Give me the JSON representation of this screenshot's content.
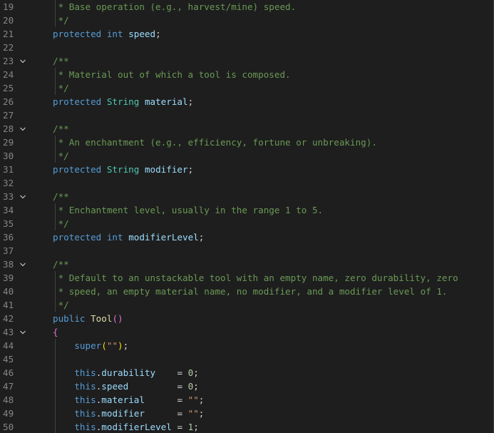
{
  "editor": {
    "lines": [
      {
        "n": "19",
        "fold": false,
        "guide": 1,
        "tokens": [
          {
            "c": "cm",
            "t": " * Base operation (e.g., harvest/mine) speed."
          }
        ]
      },
      {
        "n": "20",
        "fold": false,
        "guide": 1,
        "tokens": [
          {
            "c": "cm",
            "t": " */"
          }
        ]
      },
      {
        "n": "21",
        "fold": false,
        "guide": 0,
        "tokens": [
          {
            "c": "kw",
            "t": "protected"
          },
          {
            "c": "op",
            "t": " "
          },
          {
            "c": "kw",
            "t": "int"
          },
          {
            "c": "op",
            "t": " "
          },
          {
            "c": "id",
            "t": "speed"
          },
          {
            "c": "op",
            "t": ";"
          }
        ]
      },
      {
        "n": "22",
        "fold": false,
        "guide": 0,
        "tokens": []
      },
      {
        "n": "23",
        "fold": true,
        "guide": 0,
        "tokens": [
          {
            "c": "cm",
            "t": "/**"
          }
        ]
      },
      {
        "n": "24",
        "fold": false,
        "guide": 1,
        "tokens": [
          {
            "c": "cm",
            "t": " * Material out of which a tool is composed."
          }
        ]
      },
      {
        "n": "25",
        "fold": false,
        "guide": 1,
        "tokens": [
          {
            "c": "cm",
            "t": " */"
          }
        ]
      },
      {
        "n": "26",
        "fold": false,
        "guide": 0,
        "tokens": [
          {
            "c": "kw",
            "t": "protected"
          },
          {
            "c": "op",
            "t": " "
          },
          {
            "c": "ty",
            "t": "String"
          },
          {
            "c": "op",
            "t": " "
          },
          {
            "c": "id",
            "t": "material"
          },
          {
            "c": "op",
            "t": ";"
          }
        ]
      },
      {
        "n": "27",
        "fold": false,
        "guide": 0,
        "tokens": []
      },
      {
        "n": "28",
        "fold": true,
        "guide": 0,
        "tokens": [
          {
            "c": "cm",
            "t": "/**"
          }
        ]
      },
      {
        "n": "29",
        "fold": false,
        "guide": 1,
        "tokens": [
          {
            "c": "cm",
            "t": " * An enchantment (e.g., efficiency, fortune or unbreaking)."
          }
        ]
      },
      {
        "n": "30",
        "fold": false,
        "guide": 1,
        "tokens": [
          {
            "c": "cm",
            "t": " */"
          }
        ]
      },
      {
        "n": "31",
        "fold": false,
        "guide": 0,
        "tokens": [
          {
            "c": "kw",
            "t": "protected"
          },
          {
            "c": "op",
            "t": " "
          },
          {
            "c": "ty",
            "t": "String"
          },
          {
            "c": "op",
            "t": " "
          },
          {
            "c": "id",
            "t": "modifier"
          },
          {
            "c": "op",
            "t": ";"
          }
        ]
      },
      {
        "n": "32",
        "fold": false,
        "guide": 0,
        "tokens": []
      },
      {
        "n": "33",
        "fold": true,
        "guide": 0,
        "tokens": [
          {
            "c": "cm",
            "t": "/**"
          }
        ]
      },
      {
        "n": "34",
        "fold": false,
        "guide": 1,
        "tokens": [
          {
            "c": "cm",
            "t": " * Enchantment level, usually in the range 1 to 5."
          }
        ]
      },
      {
        "n": "35",
        "fold": false,
        "guide": 1,
        "tokens": [
          {
            "c": "cm",
            "t": " */"
          }
        ]
      },
      {
        "n": "36",
        "fold": false,
        "guide": 0,
        "tokens": [
          {
            "c": "kw",
            "t": "protected"
          },
          {
            "c": "op",
            "t": " "
          },
          {
            "c": "kw",
            "t": "int"
          },
          {
            "c": "op",
            "t": " "
          },
          {
            "c": "id",
            "t": "modifierLevel"
          },
          {
            "c": "op",
            "t": ";"
          }
        ]
      },
      {
        "n": "37",
        "fold": false,
        "guide": 0,
        "tokens": []
      },
      {
        "n": "38",
        "fold": true,
        "guide": 0,
        "tokens": [
          {
            "c": "cm",
            "t": "/**"
          }
        ]
      },
      {
        "n": "39",
        "fold": false,
        "guide": 1,
        "tokens": [
          {
            "c": "cm",
            "t": " * Default to an unstackable tool with an empty name, zero durability, zero"
          }
        ]
      },
      {
        "n": "40",
        "fold": false,
        "guide": 1,
        "tokens": [
          {
            "c": "cm",
            "t": " * speed, an empty material name, no modifier, and a modifier level of 1."
          }
        ]
      },
      {
        "n": "41",
        "fold": false,
        "guide": 1,
        "tokens": [
          {
            "c": "cm",
            "t": " */"
          }
        ]
      },
      {
        "n": "42",
        "fold": false,
        "guide": 0,
        "tokens": [
          {
            "c": "kw",
            "t": "public"
          },
          {
            "c": "op",
            "t": " "
          },
          {
            "c": "fn",
            "t": "Tool"
          },
          {
            "c": "br2",
            "t": "()"
          }
        ]
      },
      {
        "n": "43",
        "fold": true,
        "guide": 0,
        "tokens": [
          {
            "c": "br2",
            "t": "{"
          }
        ]
      },
      {
        "n": "44",
        "fold": false,
        "guide": 1,
        "tokens": [
          {
            "c": "op",
            "t": "    "
          },
          {
            "c": "kw",
            "t": "super"
          },
          {
            "c": "br",
            "t": "("
          },
          {
            "c": "str",
            "t": "\"\""
          },
          {
            "c": "br",
            "t": ")"
          },
          {
            "c": "op",
            "t": ";"
          }
        ]
      },
      {
        "n": "45",
        "fold": false,
        "guide": 1,
        "tokens": []
      },
      {
        "n": "46",
        "fold": false,
        "guide": 1,
        "tokens": [
          {
            "c": "op",
            "t": "    "
          },
          {
            "c": "kw",
            "t": "this"
          },
          {
            "c": "op",
            "t": "."
          },
          {
            "c": "id",
            "t": "durability"
          },
          {
            "c": "op",
            "t": "    = "
          },
          {
            "c": "num",
            "t": "0"
          },
          {
            "c": "op",
            "t": ";"
          }
        ]
      },
      {
        "n": "47",
        "fold": false,
        "guide": 1,
        "tokens": [
          {
            "c": "op",
            "t": "    "
          },
          {
            "c": "kw",
            "t": "this"
          },
          {
            "c": "op",
            "t": "."
          },
          {
            "c": "id",
            "t": "speed"
          },
          {
            "c": "op",
            "t": "         = "
          },
          {
            "c": "num",
            "t": "0"
          },
          {
            "c": "op",
            "t": ";"
          }
        ]
      },
      {
        "n": "48",
        "fold": false,
        "guide": 1,
        "tokens": [
          {
            "c": "op",
            "t": "    "
          },
          {
            "c": "kw",
            "t": "this"
          },
          {
            "c": "op",
            "t": "."
          },
          {
            "c": "id",
            "t": "material"
          },
          {
            "c": "op",
            "t": "      = "
          },
          {
            "c": "str",
            "t": "\"\""
          },
          {
            "c": "op",
            "t": ";"
          }
        ]
      },
      {
        "n": "49",
        "fold": false,
        "guide": 1,
        "tokens": [
          {
            "c": "op",
            "t": "    "
          },
          {
            "c": "kw",
            "t": "this"
          },
          {
            "c": "op",
            "t": "."
          },
          {
            "c": "id",
            "t": "modifier"
          },
          {
            "c": "op",
            "t": "      = "
          },
          {
            "c": "str",
            "t": "\"\""
          },
          {
            "c": "op",
            "t": ";"
          }
        ]
      },
      {
        "n": "50",
        "fold": false,
        "guide": 1,
        "tokens": [
          {
            "c": "op",
            "t": "    "
          },
          {
            "c": "kw",
            "t": "this"
          },
          {
            "c": "op",
            "t": "."
          },
          {
            "c": "id",
            "t": "modifierLevel"
          },
          {
            "c": "op",
            "t": " = "
          },
          {
            "c": "num",
            "t": "1"
          },
          {
            "c": "op",
            "t": ";"
          }
        ]
      }
    ]
  }
}
